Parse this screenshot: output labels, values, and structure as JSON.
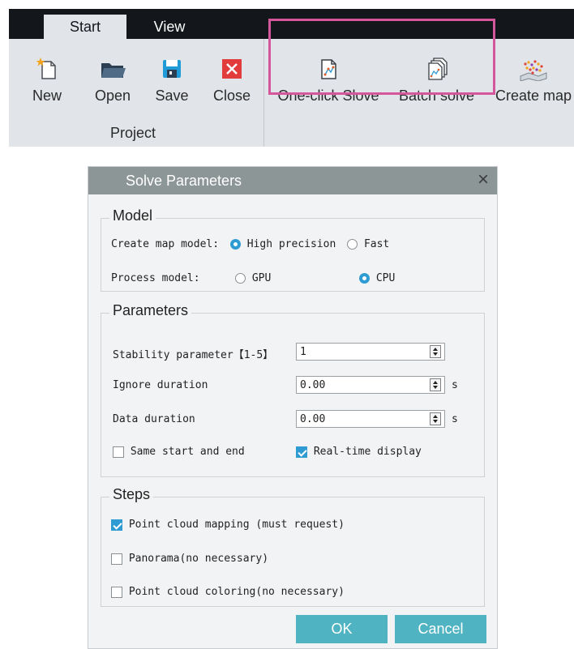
{
  "ribbon": {
    "tabs": [
      {
        "label": "Start",
        "active": true
      },
      {
        "label": "View",
        "active": false
      }
    ],
    "tools": [
      {
        "label": "New",
        "icon": "new-file-icon"
      },
      {
        "label": "Open",
        "icon": "folder-icon"
      },
      {
        "label": "Save",
        "icon": "save-icon"
      },
      {
        "label": "Close",
        "icon": "close-icon"
      },
      {
        "label": "One-click Slove",
        "icon": "one-click-solve-icon"
      },
      {
        "label": "Batch solve",
        "icon": "batch-solve-icon"
      },
      {
        "label": "Create map",
        "icon": "create-map-icon"
      }
    ],
    "group_label": "Project"
  },
  "dialog": {
    "title": "Solve Parameters",
    "model": {
      "title": "Model",
      "create_map_label": "Create map model:",
      "create_map_options": [
        {
          "label": "High precision",
          "selected": true
        },
        {
          "label": "Fast",
          "selected": false
        }
      ],
      "process_label": "Process model:",
      "process_options": [
        {
          "label": "GPU",
          "selected": false
        },
        {
          "label": "CPU",
          "selected": true
        }
      ]
    },
    "parameters": {
      "title": "Parameters",
      "stability_label": "Stability parameter【1-5】",
      "stability_value": "1",
      "ignore_label": "Ignore duration",
      "ignore_value": "0.00",
      "ignore_unit": "s",
      "data_label": "Data duration",
      "data_value": "0.00",
      "data_unit": "s",
      "same_start_end": {
        "label": "Same start and end",
        "checked": false
      },
      "realtime_display": {
        "label": "Real-time display",
        "checked": true
      }
    },
    "steps": {
      "title": "Steps",
      "items": [
        {
          "label": "Point cloud mapping (must request)",
          "checked": true
        },
        {
          "label": "Panorama(no necessary)",
          "checked": false
        },
        {
          "label": "Point cloud coloring(no necessary)",
          "checked": false
        }
      ]
    },
    "buttons": {
      "ok": "OK",
      "cancel": "Cancel"
    }
  },
  "colors": {
    "accent": "#2f9bd3",
    "button": "#4fb3c2",
    "highlight": "#d4579c",
    "titlebar": "#8d9696"
  }
}
